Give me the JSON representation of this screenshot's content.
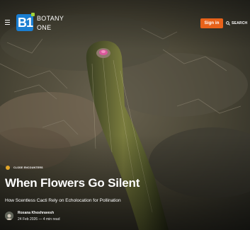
{
  "header": {
    "logo_mark": "B1",
    "logo_line1": "BOTANY",
    "logo_line2": "ONE",
    "signin_label": "Sign in",
    "search_label": "SEARCH"
  },
  "article": {
    "category": "CLOSE ENCOUNTERS",
    "title": "When Flowers Go Silent",
    "subtitle": "How Scentless Cacti Rely on Echolocation for Pollination",
    "author": "Roxana Khoshravesh",
    "meta": "24 Feb 2026 — 4 min read"
  },
  "colors": {
    "brand_blue": "#1a7ed1",
    "brand_green": "#9fd23a",
    "signin_orange": "#e8621a",
    "badge_gold": "#e3a62a"
  },
  "icons": [
    "menu-icon",
    "search-icon",
    "category-dot-icon"
  ]
}
